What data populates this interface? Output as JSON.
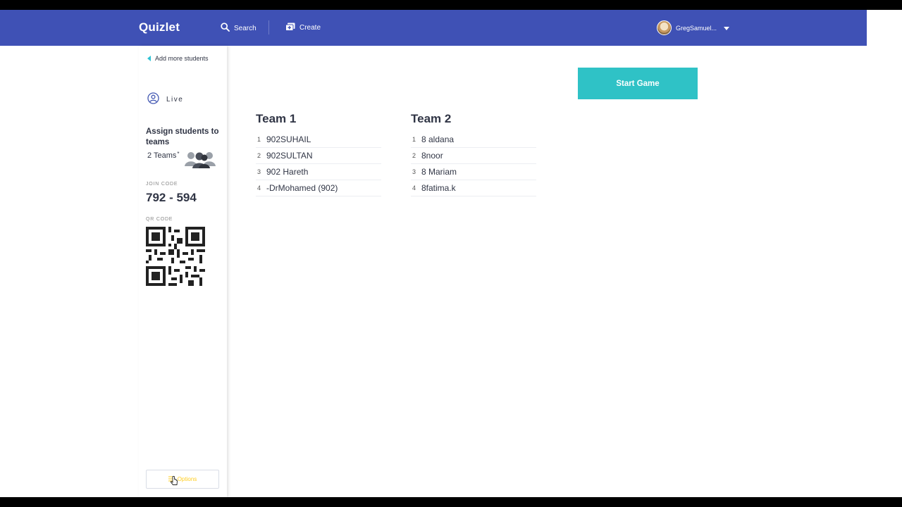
{
  "header": {
    "logo": "Quizlet",
    "search_label": "Search",
    "create_label": "Create",
    "username": "GregSamuel..."
  },
  "sidebar": {
    "back_label": "Add more students",
    "live_label": "Live",
    "assign_title": "Assign students to teams",
    "teams_count": "2 Teams",
    "teams_marker": "*",
    "join_code_label": "JOIN CODE",
    "join_code": "792 - 594",
    "qr_label": "QR CODE",
    "options_label": "Options"
  },
  "main": {
    "start_button": "Start Game",
    "teams": [
      {
        "name": "Team 1",
        "players": [
          {
            "num": "1",
            "name": "902SUHAIL"
          },
          {
            "num": "2",
            "name": "902SULTAN"
          },
          {
            "num": "3",
            "name": "902 Hareth"
          },
          {
            "num": "4",
            "name": "-DrMohamed (902)"
          }
        ]
      },
      {
        "name": "Team 2",
        "players": [
          {
            "num": "1",
            "name": "8 aldana"
          },
          {
            "num": "2",
            "name": "8noor"
          },
          {
            "num": "3",
            "name": "8 Mariam"
          },
          {
            "num": "4",
            "name": "8fatima.k"
          }
        ]
      }
    ]
  },
  "colors": {
    "header_bg": "#3f51b5",
    "accent_teal": "#2fc2c6",
    "options_yellow": "#ffcd1f"
  }
}
